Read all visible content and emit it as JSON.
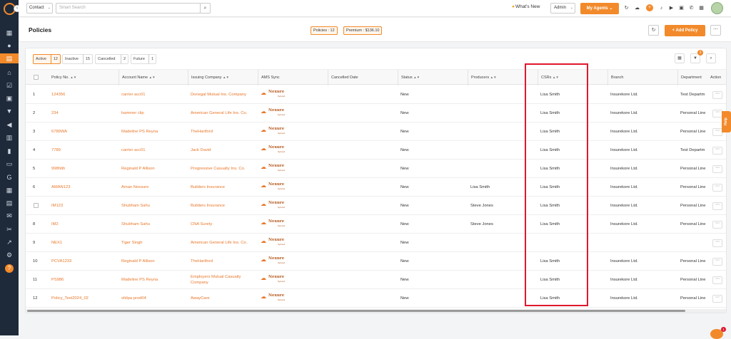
{
  "topbar": {
    "search_type": "Contact",
    "search_placeholder": "Smart Search",
    "whats_new": "What's New",
    "role": "Admin",
    "my_agents": "My Agents"
  },
  "header": {
    "title": "Policies",
    "policies_pill": "Policies : 12",
    "premium_pill": "Premium : $136.10",
    "add_policy": "+ Add Policy"
  },
  "tabs": [
    {
      "label": "Active",
      "count": "12"
    },
    {
      "label": "Inactive",
      "count": "15"
    },
    {
      "label": "Cancelled",
      "count": "2"
    },
    {
      "label": "Future",
      "count": "1"
    }
  ],
  "filter_badge": "3",
  "columns": {
    "policy_no": "Policy No.",
    "account_name": "Account Name",
    "issuing_company": "Issuing Company",
    "ams_sync": "AMS Sync",
    "cancelled_date": "Cancelled Date",
    "status": "Status",
    "producers": "Producers",
    "csrs": "CSRs",
    "branch": "Branch",
    "department": "Department",
    "action": "Action"
  },
  "ams_logo": {
    "name": "Nexure",
    "sub": "Synced"
  },
  "rows": [
    {
      "n": "1",
      "policy": "124356",
      "account": "carrier acc01",
      "company": "Donegal Mutual Ins. Company",
      "status": "New",
      "producer": "",
      "csr": "Lisa Smith",
      "branch": "Insurekore Ltd.",
      "dept": "Test Departm"
    },
    {
      "n": "2",
      "policy": "234",
      "account": "hammer clip",
      "company": "American General Life Ins. Co.",
      "status": "New",
      "producer": "",
      "csr": "Lisa Smith",
      "branch": "Insurekore Ltd.",
      "dept": "Personal Line"
    },
    {
      "n": "3",
      "policy": "6789WA",
      "account": "Madeline PS Reyna",
      "company": "TheHartford",
      "status": "New",
      "producer": "",
      "csr": "Lisa Smith",
      "branch": "Insurekore Ltd.",
      "dept": "Personal Line"
    },
    {
      "n": "4",
      "policy": "7789",
      "account": "carrier acc01",
      "company": "Jack David",
      "status": "New",
      "producer": "",
      "csr": "Lisa Smith",
      "branch": "Insurekore Ltd.",
      "dept": "Test Departm"
    },
    {
      "n": "5",
      "policy": "998htth",
      "account": "Reginald P Allison",
      "company": "Progressive Casualty Ins. Co.",
      "status": "New",
      "producer": "",
      "csr": "Lisa Smith",
      "branch": "Insurekore Ltd.",
      "dept": "Personal Line"
    },
    {
      "n": "6",
      "policy": "AMAN123",
      "account": "Aman Nexsure",
      "company": "Builders Insurance",
      "status": "New",
      "producer": "Lisa Smith",
      "csr": "Lisa Smith",
      "branch": "Insurekore Ltd.",
      "dept": "Personal Line"
    },
    {
      "n": "7",
      "policy": "IM123",
      "account": "Shubham Sahu",
      "company": "Builders Insurance",
      "status": "New",
      "producer": "Steve Jones",
      "csr": "Lisa Smith",
      "branch": "Insurekore Ltd.",
      "dept": "Personal Line"
    },
    {
      "n": "8",
      "policy": "IM2",
      "account": "Shubham Sahu",
      "company": "CNA Surety",
      "status": "New",
      "producer": "Steve Jones",
      "csr": "Lisa Smith",
      "branch": "Insurekore Ltd.",
      "dept": "Personal Line"
    },
    {
      "n": "9",
      "policy": "NEX1",
      "account": "Tiger Singh",
      "company": "American General Life Ins. Co.",
      "status": "New",
      "producer": "",
      "csr": "",
      "branch": "",
      "dept": ""
    },
    {
      "n": "10",
      "policy": "PCVA1233",
      "account": "Reginald P Allison",
      "company": "TheHartford",
      "status": "New",
      "producer": "",
      "csr": "Lisa Smith",
      "branch": "Insurekore Ltd.",
      "dept": "Personal Line"
    },
    {
      "n": "11",
      "policy": "PS986",
      "account": "Madeline PS Reyna",
      "company": "Employers Mutual Casualty Company",
      "status": "New",
      "producer": "",
      "csr": "Lisa Smith",
      "branch": "Insurekore Ltd.",
      "dept": "Personal Line"
    },
    {
      "n": "12",
      "policy": "Policy_Test2024_02",
      "account": "shilpa prod04",
      "company": "AwayCare",
      "status": "New",
      "producer": "",
      "csr": "Lisa Smith",
      "branch": "Insurekore Ltd.",
      "dept": "Personal Line"
    }
  ],
  "help_label": "Help",
  "chat_badge": "1",
  "colors": {
    "accent": "#f28a2b",
    "sidebar": "#1e2a3a",
    "highlight": "#e0182d",
    "link": "#e9772a"
  }
}
